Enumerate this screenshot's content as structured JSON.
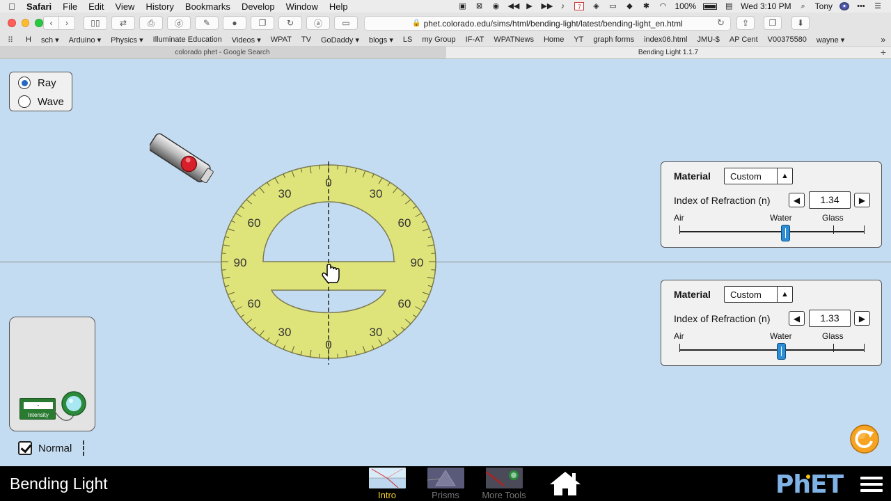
{
  "menubar": {
    "app": "Safari",
    "items": [
      "File",
      "Edit",
      "View",
      "History",
      "Bookmarks",
      "Develop",
      "Window",
      "Help"
    ],
    "battery": "100%",
    "clock": "Wed 3:10 PM",
    "user": "Tony",
    "calendar_day": "7"
  },
  "toolbar": {
    "url": "phet.colorado.edu/sims/html/bending-light/latest/bending-light_en.html"
  },
  "bookmarks": [
    "H",
    "sch ▾",
    "Arduino ▾",
    "Physics ▾",
    "Illuminate Education",
    "Videos ▾",
    "WPAT",
    "TV",
    "GoDaddy ▾",
    "blogs ▾",
    "LS",
    "my Group",
    "IF-AT",
    "WPATNews",
    "Home",
    "YT",
    "graph forms",
    "index06.html",
    "JMU-$",
    "AP Cent",
    "V00375580",
    "wayne ▾"
  ],
  "tabs": [
    {
      "title": "colorado phet - Google Search",
      "active": false
    },
    {
      "title": "Bending Light 1.1.7",
      "active": true
    }
  ],
  "sim": {
    "mode": {
      "options": [
        "Ray",
        "Wave"
      ],
      "selected": "Ray"
    },
    "protractor": {
      "top_labels": {
        "left30": "30",
        "left60": "60",
        "left90": "90",
        "zero": "0",
        "right30": "30",
        "right60": "60",
        "right90": "90"
      },
      "bottom_labels": {
        "left60": "60",
        "left30": "30",
        "zero": "0",
        "right30": "30",
        "right60": "60"
      }
    },
    "toolbox": {
      "intensity_label": "Intensity",
      "intensity_readout": "-"
    },
    "normal": {
      "label": "Normal",
      "checked": true
    },
    "material_top": {
      "label": "Material",
      "selection": "Custom",
      "ior_label": "Index of Refraction (n)",
      "ior_value": "1.34",
      "slider_labels": {
        "air": "Air",
        "water": "Water",
        "glass": "Glass"
      },
      "slider_fraction": 0.57
    },
    "material_bottom": {
      "label": "Material",
      "selection": "Custom",
      "ior_label": "Index of Refraction (n)",
      "ior_value": "1.33",
      "slider_labels": {
        "air": "Air",
        "water": "Water",
        "glass": "Glass"
      },
      "slider_fraction": 0.55
    }
  },
  "navbar": {
    "title": "Bending Light",
    "screens": [
      {
        "label": "Intro",
        "active": true
      },
      {
        "label": "Prisms",
        "active": false
      },
      {
        "label": "More Tools",
        "active": false
      }
    ],
    "logo": "PhET"
  },
  "colors": {
    "sim_background": "#c4dcf1",
    "protractor_fill": "#dfe47a",
    "active_screen": "#f7d22a",
    "slider_thumb": "#2d8ed6",
    "reset_button": "#f5a320"
  }
}
